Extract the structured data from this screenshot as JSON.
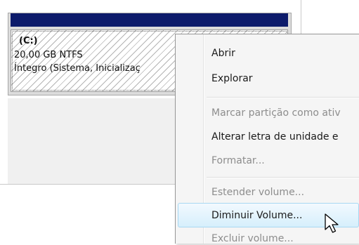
{
  "partition": {
    "label": "(C:)",
    "size_fs": "20,00 GB NTFS",
    "status": "Íntegro (Sistema, Inicializaç"
  },
  "context_menu": {
    "items": [
      {
        "label": "Abrir",
        "enabled": true
      },
      {
        "label": "Explorar",
        "enabled": true
      },
      {
        "label": "Marcar partição como ativ",
        "enabled": false
      },
      {
        "label": "Alterar letra de unidade e",
        "enabled": true
      },
      {
        "label": "Formatar...",
        "enabled": false
      },
      {
        "label": "Estender volume...",
        "enabled": false
      },
      {
        "label": "Diminuir Volume...",
        "enabled": true,
        "highlighted": true
      },
      {
        "label": "Excluir volume...",
        "enabled": false
      }
    ]
  },
  "colors": {
    "partition_header": "#0d1b6b",
    "menu_highlight_border": "#a8d8f2",
    "disabled_text": "#8d8d8d"
  },
  "icons": {
    "cursor": "arrow-cursor-icon"
  }
}
